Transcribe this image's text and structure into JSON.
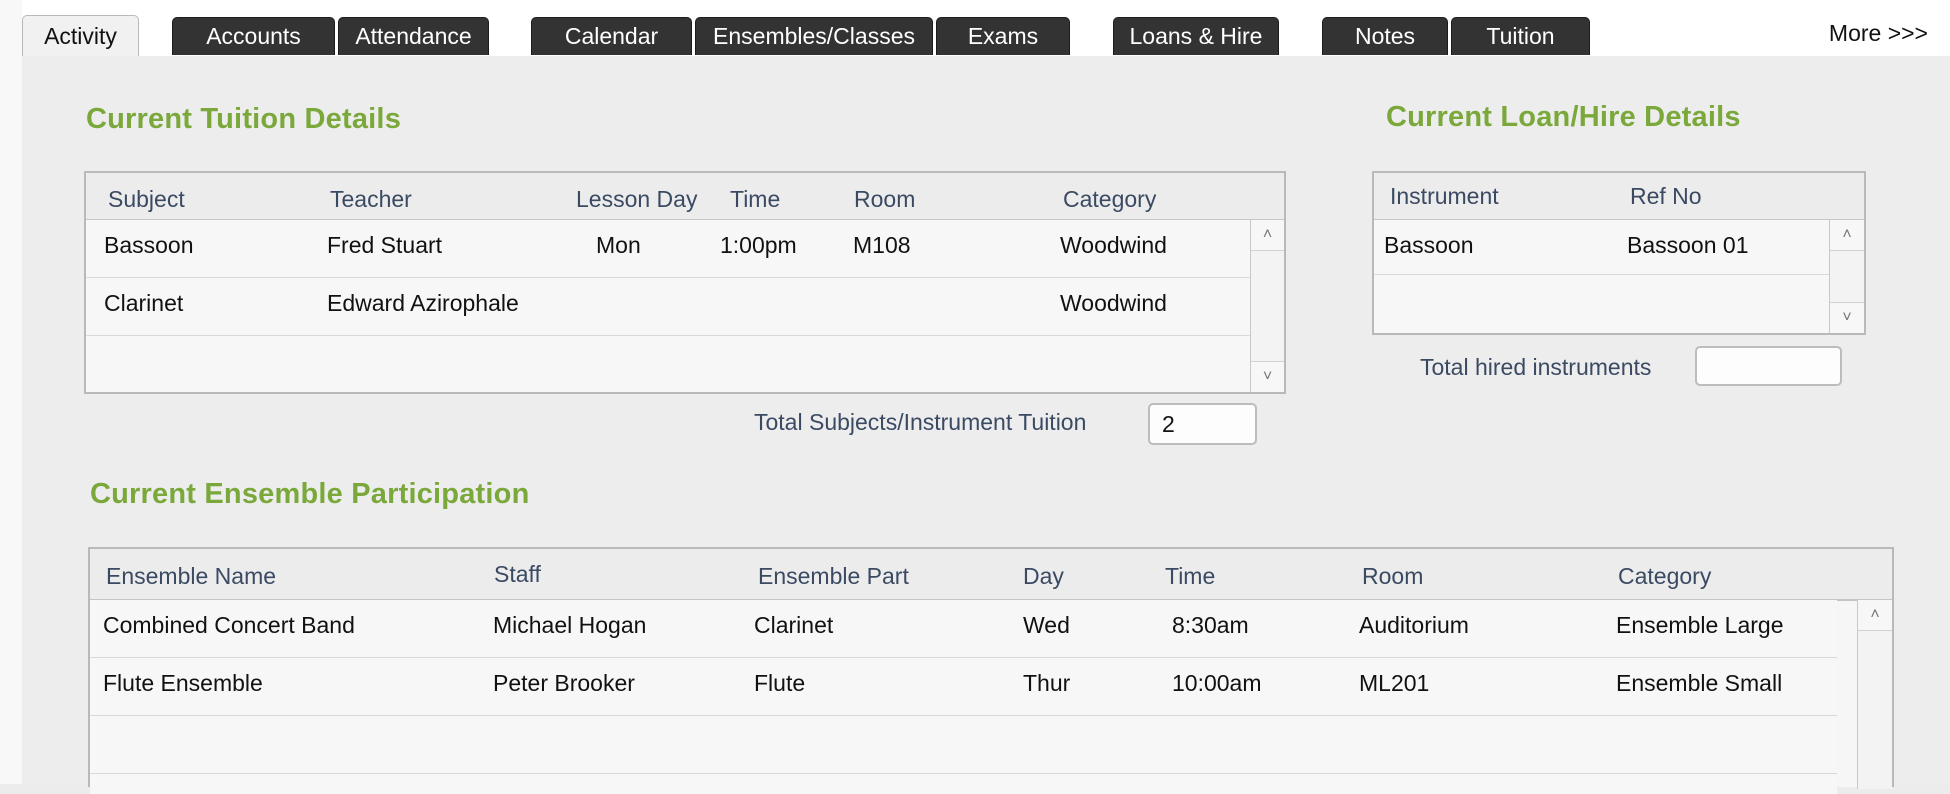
{
  "tabs": [
    {
      "label": "Activity",
      "active": true
    },
    {
      "label": "Accounts"
    },
    {
      "label": "Attendance"
    },
    {
      "label": "Calendar"
    },
    {
      "label": "Ensembles/Classes"
    },
    {
      "label": "Exams"
    },
    {
      "label": "Loans & Hire"
    },
    {
      "label": "Notes"
    },
    {
      "label": "Tuition"
    }
  ],
  "more_label": "More >>>",
  "tuition": {
    "title": "Current Tuition Details",
    "headers": [
      "Subject",
      "Teacher",
      "Lesson Day",
      "Time",
      "Room",
      "Category"
    ],
    "rows": [
      {
        "subject": "Bassoon",
        "teacher": "Fred Stuart",
        "day": "Mon",
        "time": "1:00pm",
        "room": "M108",
        "category": "Woodwind"
      },
      {
        "subject": "Clarinet",
        "teacher": "Edward Azirophale",
        "day": "",
        "time": "",
        "room": "",
        "category": "Woodwind"
      }
    ],
    "total_label": "Total Subjects/Instrument Tuition",
    "total_value": "2"
  },
  "loans": {
    "title": "Current Loan/Hire Details",
    "headers": [
      "Instrument",
      "Ref No"
    ],
    "rows": [
      {
        "instrument": "Bassoon",
        "ref": "Bassoon 01"
      }
    ],
    "total_label": "Total hired instruments",
    "total_value": ""
  },
  "ensembles": {
    "title": "Current Ensemble Participation",
    "headers": [
      "Ensemble Name",
      "Staff",
      "Ensemble Part",
      "Day",
      "Time",
      "Room",
      "Category"
    ],
    "rows": [
      {
        "name": "Combined Concert Band",
        "staff": "Michael Hogan",
        "part": "Clarinet",
        "day": "Wed",
        "time": "8:30am",
        "room": "Auditorium",
        "category": "Ensemble Large"
      },
      {
        "name": "Flute Ensemble",
        "staff": "Peter Brooker",
        "part": "Flute",
        "day": "Thur",
        "time": "10:00am",
        "room": "ML201",
        "category": "Ensemble Small"
      }
    ]
  },
  "icons": {
    "scroll_up": "chevron-up-icon",
    "scroll_down": "chevron-down-icon"
  },
  "colors": {
    "section_title": "#7aa83b",
    "header_text": "#3b4a63",
    "tab_dark": "#333333"
  }
}
